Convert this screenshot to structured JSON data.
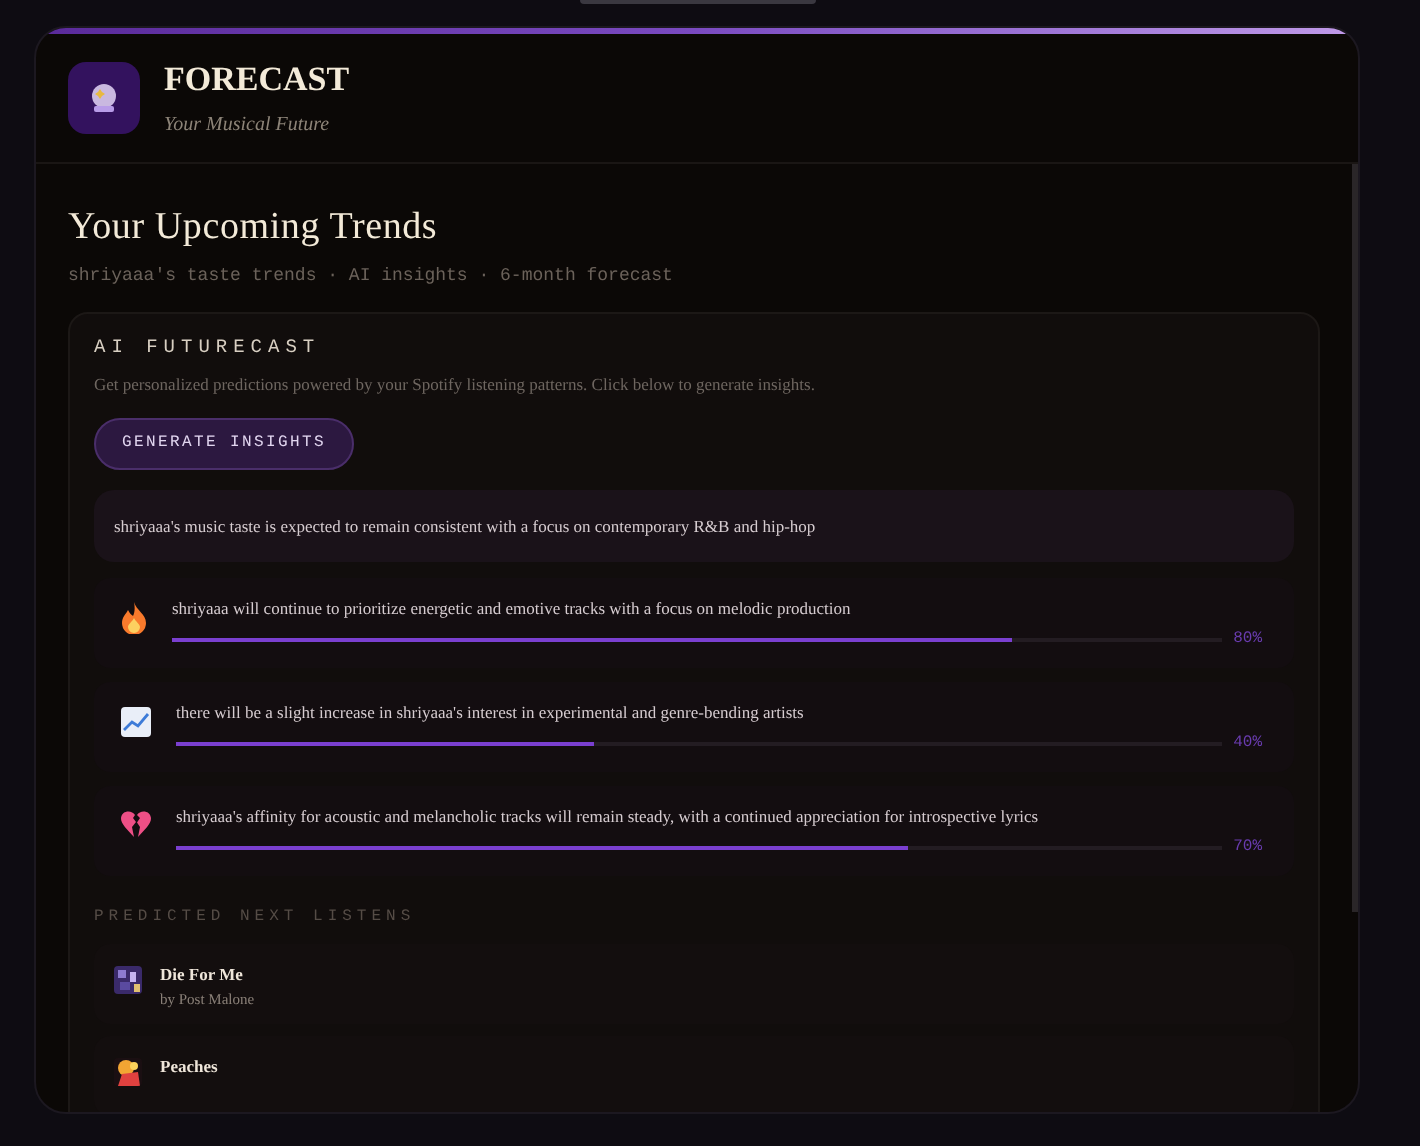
{
  "app": {
    "title": "FORECAST",
    "subtitle": "Your Musical Future"
  },
  "page": {
    "title": "Your Upcoming Trends",
    "meta": "shriyaaa's taste trends · AI insights · 6-month forecast"
  },
  "futurecast": {
    "heading": "AI FUTURECAST",
    "description": "Get personalized predictions powered by your Spotify listening patterns. Click below to generate insights.",
    "button": "GENERATE INSIGHTS",
    "summary": "shriyaaa's music taste is expected to remain consistent with a focus on contemporary R&B and hip-hop",
    "predictions": [
      {
        "kind": "fire",
        "text": "shriyaaa will continue to prioritize energetic and emotive tracks with a focus on melodic production",
        "level": 0.8,
        "reading": "80%"
      },
      {
        "kind": "chart",
        "text": "there will be a slight increase in shriyaaa's interest in experimental and genre-bending artists",
        "level": 0.4,
        "reading": "40%"
      },
      {
        "kind": "broken-heart",
        "text": "shriyaaa's affinity for acoustic and melancholic tracks will remain steady, with a continued appreciation for introspective lyrics",
        "level": 0.7,
        "reading": "70%"
      }
    ]
  },
  "next_listens": {
    "heading": "PREDICTED NEXT LISTENS",
    "tracks": [
      {
        "title": "Die For Me",
        "artist": "by Post Malone"
      },
      {
        "title": "Peaches"
      }
    ]
  }
}
